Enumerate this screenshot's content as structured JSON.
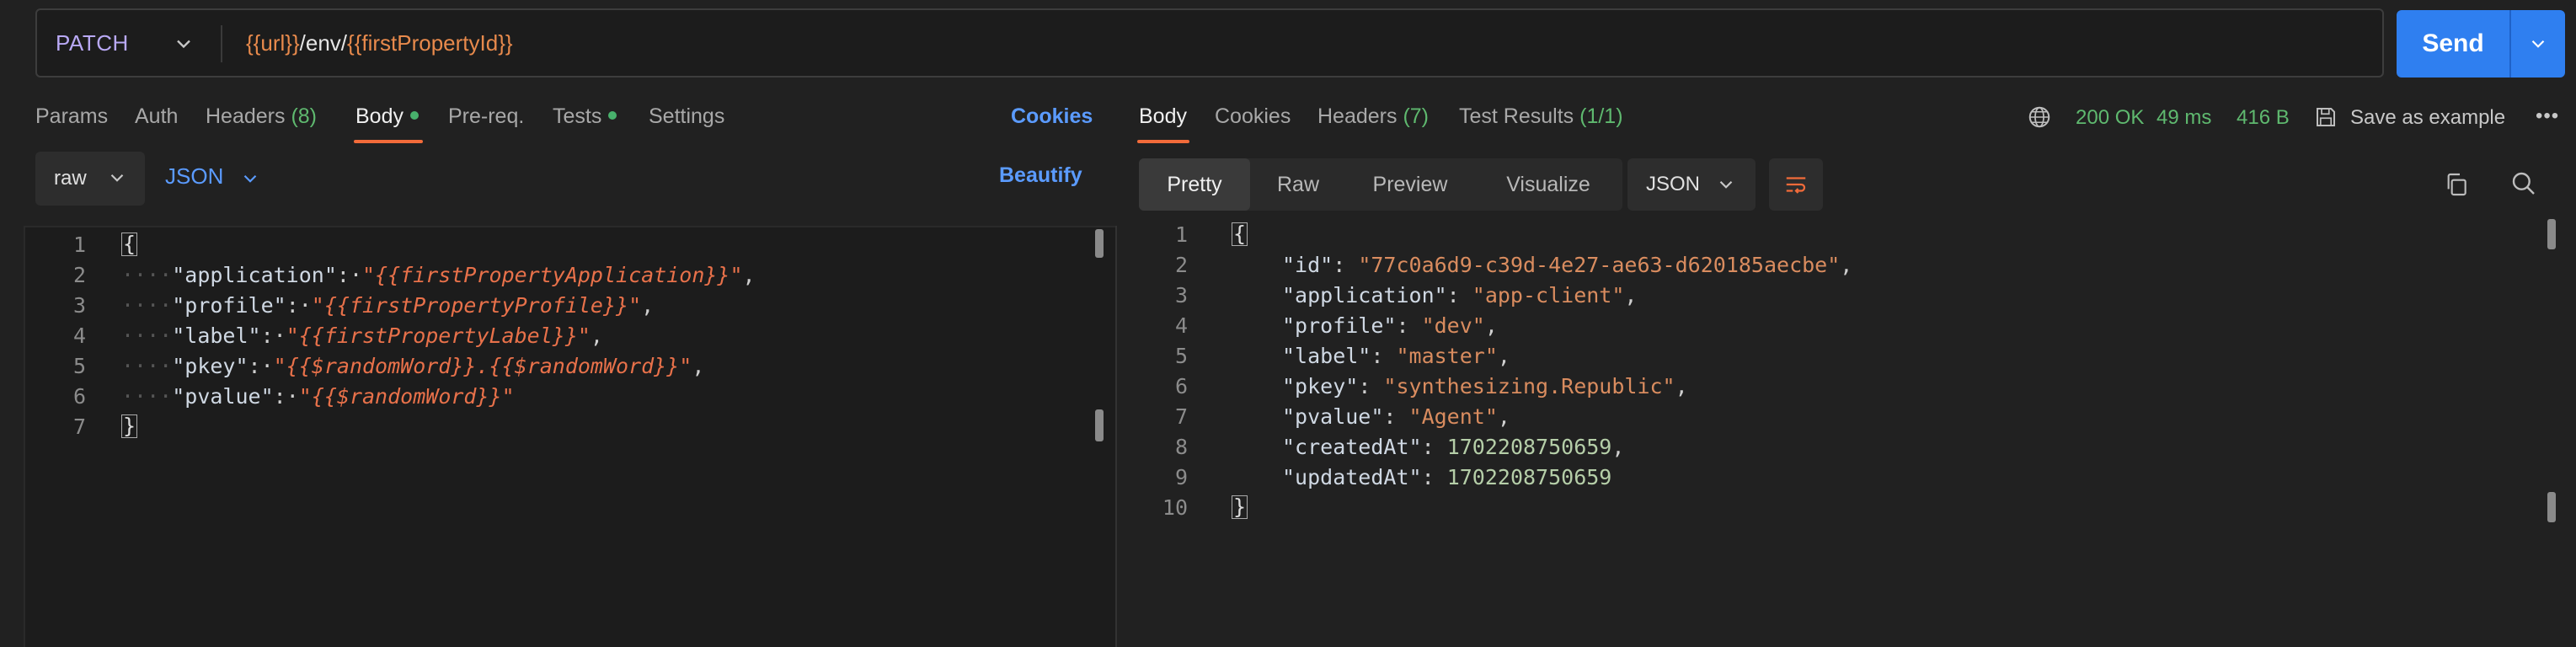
{
  "request": {
    "method": "PATCH",
    "url_parts": [
      {
        "text": "{{url}}",
        "kind": "var"
      },
      {
        "text": "/env/",
        "kind": "plain"
      },
      {
        "text": "{{firstPropertyId}}",
        "kind": "var"
      }
    ],
    "send_label": "Send"
  },
  "request_tabs": {
    "params": "Params",
    "auth": "Auth",
    "headers": "Headers",
    "headers_count": "(8)",
    "body": "Body",
    "prereq": "Pre-req.",
    "tests": "Tests",
    "settings": "Settings",
    "cookies": "Cookies",
    "active": "Body"
  },
  "body_options": {
    "mode": "raw",
    "format": "JSON",
    "beautify": "Beautify"
  },
  "request_body_lines": [
    {
      "n": "1",
      "text": "{"
    },
    {
      "n": "2",
      "key": "\"application\"",
      "value": "\"{{firstPropertyApplication}}\"",
      "comma": ","
    },
    {
      "n": "3",
      "key": "\"profile\"",
      "value": "\"{{firstPropertyProfile}}\"",
      "comma": ","
    },
    {
      "n": "4",
      "key": "\"label\"",
      "value": "\"{{firstPropertyLabel}}\"",
      "comma": ","
    },
    {
      "n": "5",
      "key": "\"pkey\"",
      "value": "\"{{$randomWord}}.{{$randomWord}}\"",
      "comma": ","
    },
    {
      "n": "6",
      "key": "\"pvalue\"",
      "value": "\"{{$randomWord}}\"",
      "comma": ""
    },
    {
      "n": "7",
      "text": "}"
    }
  ],
  "response_tabs": {
    "body": "Body",
    "cookies": "Cookies",
    "headers": "Headers",
    "headers_count": "(7)",
    "test_results": "Test Results",
    "test_results_count": "(1/1)",
    "active": "Body"
  },
  "response_meta": {
    "status": "200 OK",
    "time": "49 ms",
    "size": "416 B",
    "save_label": "Save as example",
    "more": "•••"
  },
  "response_views": [
    "Pretty",
    "Raw",
    "Preview",
    "Visualize"
  ],
  "response_active_view": "Pretty",
  "response_format": "JSON",
  "response_body_lines": [
    {
      "n": "1",
      "text": "{"
    },
    {
      "n": "2",
      "key": "\"id\"",
      "value": "\"77c0a6d9-c39d-4e27-ae63-d620185aecbe\"",
      "type": "str",
      "comma": ","
    },
    {
      "n": "3",
      "key": "\"application\"",
      "value": "\"app-client\"",
      "type": "str",
      "comma": ","
    },
    {
      "n": "4",
      "key": "\"profile\"",
      "value": "\"dev\"",
      "type": "str",
      "comma": ","
    },
    {
      "n": "5",
      "key": "\"label\"",
      "value": "\"master\"",
      "type": "str",
      "comma": ","
    },
    {
      "n": "6",
      "key": "\"pkey\"",
      "value": "\"synthesizing.Republic\"",
      "type": "str",
      "comma": ","
    },
    {
      "n": "7",
      "key": "\"pvalue\"",
      "value": "\"Agent\"",
      "type": "str",
      "comma": ","
    },
    {
      "n": "8",
      "key": "\"createdAt\"",
      "value": "1702208750659",
      "type": "num",
      "comma": ","
    },
    {
      "n": "9",
      "key": "\"updatedAt\"",
      "value": "1702208750659",
      "type": "num",
      "comma": ""
    },
    {
      "n": "10",
      "text": "}"
    }
  ],
  "colors": {
    "accent": "#f26b3a",
    "send": "#2f7ff0",
    "link": "#5b9bff",
    "success": "#5fb96f"
  }
}
